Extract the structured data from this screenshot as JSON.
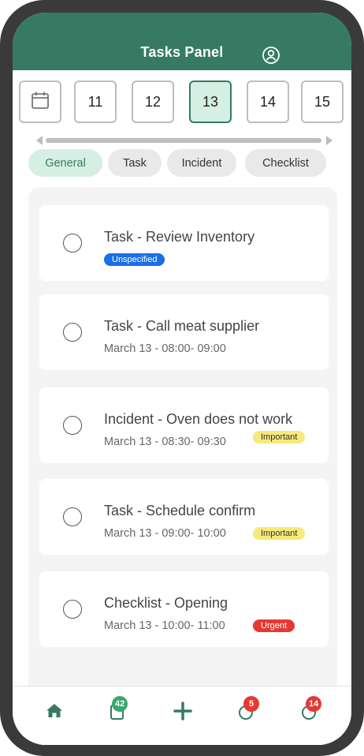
{
  "colors": {
    "brand": "#367a63",
    "accent_light": "#d6efe4",
    "unspecified": "#1a6ee8",
    "important": "#f7e97a",
    "urgent": "#e53935",
    "nav_badge_green": "#3aa86b",
    "nav_badge_red": "#e53935"
  },
  "header": {
    "title": "Tasks Panel",
    "user_icon": "user-circle-icon"
  },
  "dates": {
    "calendar_icon": "calendar-icon",
    "days": [
      "11",
      "12",
      "13",
      "14",
      "15"
    ],
    "selected_day": "13"
  },
  "filters": [
    {
      "label": "General",
      "active": true
    },
    {
      "label": "Task",
      "active": false
    },
    {
      "label": "Incident",
      "active": false
    },
    {
      "label": "Checklist",
      "active": false
    }
  ],
  "tasks": [
    {
      "title": "Task - Review Inventory",
      "time": "",
      "badge": "Unspecified",
      "badge_type": "unspecified"
    },
    {
      "title": "Task - Call meat supplier",
      "time": "March 13 - 08:00- 09:00",
      "badge": "",
      "badge_type": ""
    },
    {
      "title": "Incident - Oven does not work",
      "time": "March 13 - 08:30- 09:30",
      "badge": "Important",
      "badge_type": "important"
    },
    {
      "title": "Task - Schedule confirm",
      "time": "March 13 - 09:00- 10:00",
      "badge": "Important",
      "badge_type": "important"
    },
    {
      "title": "Checklist - Opening",
      "time": "March 13 - 10:00- 11:00",
      "badge": "Urgent",
      "badge_type": "urgent"
    }
  ],
  "nav": {
    "home_icon": "home-icon",
    "clipboard_icon": "clipboard-icon",
    "clipboard_count": "42",
    "add_icon": "plus-icon",
    "pending_icon": "progress-circle-icon",
    "pending_count": "5",
    "done_icon": "progress-circle-icon",
    "done_count": "14"
  }
}
